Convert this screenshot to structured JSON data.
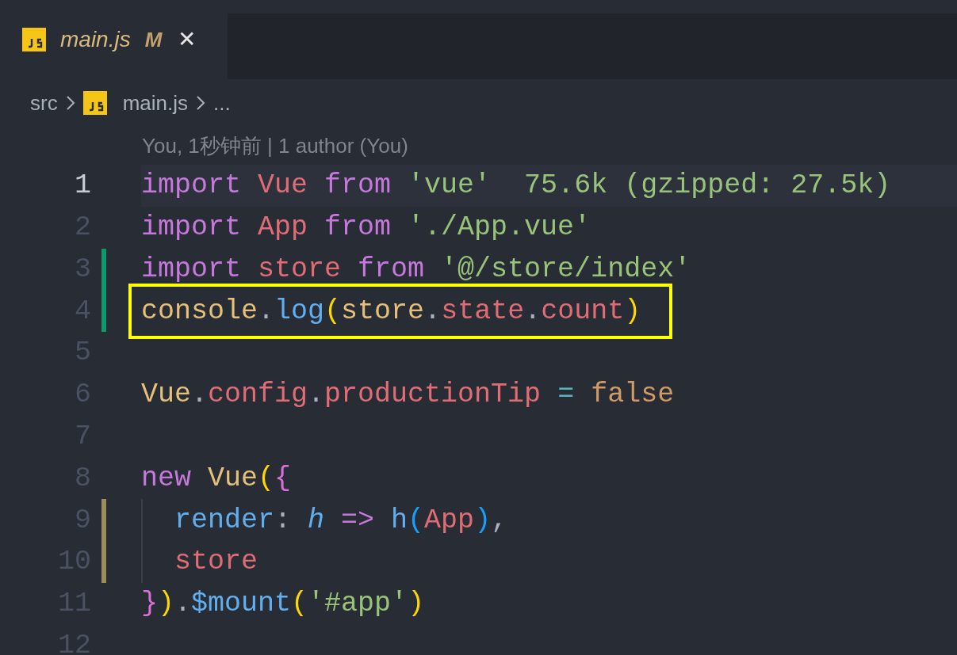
{
  "tabs": [
    {
      "label": "main.js",
      "status": "M",
      "selected": true,
      "close": "✕"
    }
  ],
  "breadcrumb": [
    {
      "label": "src",
      "kind": "folder"
    },
    {
      "label": "main.js",
      "kind": "file"
    },
    {
      "label": "...",
      "kind": "symbol"
    }
  ],
  "blame": "You, 1秒钟前 | 1 author (You)",
  "lines": [
    {
      "number": "1",
      "current": true,
      "added": false,
      "modified": false,
      "boxed": false,
      "indent_guide": false,
      "tokens": [
        {
          "text": "import ",
          "kind": "keyword"
        },
        {
          "text": "Vue ",
          "kind": "variable"
        },
        {
          "text": "from ",
          "kind": "keyword"
        },
        {
          "text": "'vue'",
          "kind": "string"
        },
        {
          "text": "  75.6k (gzipped: 27.5k)",
          "kind": "size"
        }
      ]
    },
    {
      "number": "2",
      "current": false,
      "added": false,
      "modified": false,
      "boxed": false,
      "indent_guide": false,
      "tokens": [
        {
          "text": "import ",
          "kind": "keyword"
        },
        {
          "text": "App ",
          "kind": "variable"
        },
        {
          "text": "from ",
          "kind": "keyword"
        },
        {
          "text": "'./App.vue'",
          "kind": "string"
        }
      ]
    },
    {
      "number": "3",
      "current": false,
      "added": true,
      "modified": false,
      "boxed": false,
      "indent_guide": false,
      "tokens": [
        {
          "text": "import ",
          "kind": "keyword"
        },
        {
          "text": "store ",
          "kind": "variable"
        },
        {
          "text": "from ",
          "kind": "keyword"
        },
        {
          "text": "'@/store/index'",
          "kind": "string"
        }
      ]
    },
    {
      "number": "4",
      "current": false,
      "added": true,
      "modified": false,
      "boxed": true,
      "indent_guide": false,
      "tokens": [
        {
          "text": "console",
          "kind": "class"
        },
        {
          "text": ".",
          "kind": "plain"
        },
        {
          "text": "log",
          "kind": "function"
        },
        {
          "text": "(",
          "kind": "bracket1"
        },
        {
          "text": "store",
          "kind": "class"
        },
        {
          "text": ".",
          "kind": "plain"
        },
        {
          "text": "state",
          "kind": "variable"
        },
        {
          "text": ".",
          "kind": "plain"
        },
        {
          "text": "count",
          "kind": "variable"
        },
        {
          "text": ")",
          "kind": "bracket1"
        }
      ]
    },
    {
      "number": "5",
      "current": false,
      "added": false,
      "modified": false,
      "boxed": false,
      "indent_guide": false
    },
    {
      "number": "6",
      "current": false,
      "added": false,
      "modified": false,
      "boxed": false,
      "indent_guide": false,
      "tokens": [
        {
          "text": "Vue",
          "kind": "class"
        },
        {
          "text": ".",
          "kind": "plain"
        },
        {
          "text": "config",
          "kind": "variable"
        },
        {
          "text": ".",
          "kind": "plain"
        },
        {
          "text": "productionTip ",
          "kind": "variable"
        },
        {
          "text": "= ",
          "kind": "operator"
        },
        {
          "text": "false",
          "kind": "constant"
        }
      ]
    },
    {
      "number": "7",
      "current": false,
      "added": false,
      "modified": false,
      "boxed": false,
      "indent_guide": false
    },
    {
      "number": "8",
      "current": false,
      "added": false,
      "modified": false,
      "boxed": false,
      "indent_guide": false,
      "tokens": [
        {
          "text": "new ",
          "kind": "keyword"
        },
        {
          "text": "Vue",
          "kind": "class"
        },
        {
          "text": "(",
          "kind": "bracket1"
        },
        {
          "text": "{",
          "kind": "bracket2"
        }
      ]
    },
    {
      "number": "9",
      "current": false,
      "added": false,
      "modified": true,
      "boxed": false,
      "indent_guide": true,
      "tokens": [
        {
          "text": "render",
          "kind": "function"
        },
        {
          "text": ": ",
          "kind": "plain"
        },
        {
          "text": "h ",
          "kind": "param"
        },
        {
          "text": "=> ",
          "kind": "keyword"
        },
        {
          "text": "h",
          "kind": "function"
        },
        {
          "text": "(",
          "kind": "bracket3"
        },
        {
          "text": "App",
          "kind": "variable"
        },
        {
          "text": ")",
          "kind": "bracket3"
        },
        {
          "text": ",",
          "kind": "plain"
        }
      ]
    },
    {
      "number": "10",
      "current": false,
      "added": false,
      "modified": true,
      "boxed": false,
      "indent_guide": true,
      "tokens": [
        {
          "text": "store",
          "kind": "variable"
        }
      ]
    },
    {
      "number": "11",
      "current": false,
      "added": false,
      "modified": false,
      "boxed": false,
      "indent_guide": false,
      "tokens": [
        {
          "text": "}",
          "kind": "bracket2"
        },
        {
          "text": ")",
          "kind": "bracket1"
        },
        {
          "text": ".",
          "kind": "plain"
        },
        {
          "text": "$mount",
          "kind": "function"
        },
        {
          "text": "(",
          "kind": "bracket1"
        },
        {
          "text": "'#app'",
          "kind": "string"
        },
        {
          "text": ")",
          "kind": "bracket1"
        }
      ]
    },
    {
      "number": "12",
      "current": false,
      "added": false,
      "modified": false,
      "boxed": false,
      "indent_guide": false
    }
  ]
}
